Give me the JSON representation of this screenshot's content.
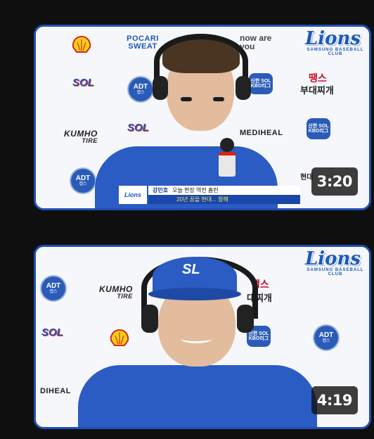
{
  "videos": [
    {
      "duration": "3:20",
      "lower_third": {
        "logo": "Lions",
        "name": "강민호",
        "caption": "오늘 현장 역전 홈런",
        "subtitle": "20년 꿈을 현대... 향해"
      },
      "sponsors": {
        "pocari": "POCARI SWEAT",
        "nowareyou": "now are you",
        "kumho": "KUMHO",
        "kumho_sub": "TIRE",
        "mediheal": "MEDIHEAL",
        "adt": "ADT",
        "adt_sub": "캡스",
        "sol": "SOL",
        "kbo": "신한 SOL KBO리그",
        "lions": "Lions",
        "lions_sub": "SAMSUNG BASEBALL CLUB",
        "tangs": "땡스",
        "budae": "부대찌개",
        "hyundai": "현대"
      }
    },
    {
      "duration": "4:19",
      "sponsors": {
        "adt": "ADT",
        "adt_sub": "캡스",
        "kumho": "KUMHO",
        "kumho_sub": "TIRE",
        "sol": "SOL",
        "mediheal": "DIHEAL",
        "kbo": "신한 SOL KBO리그",
        "lions": "Lions",
        "lions_sub": "SAMSUNG BASEBALL CLUB",
        "tangs": "땡스",
        "budae": "대찌개",
        "cap_logo": "SL"
      }
    }
  ],
  "colors": {
    "brand_blue": "#1c58b8",
    "card_border": "#1f4fb5",
    "background": "#0f0f0f"
  }
}
